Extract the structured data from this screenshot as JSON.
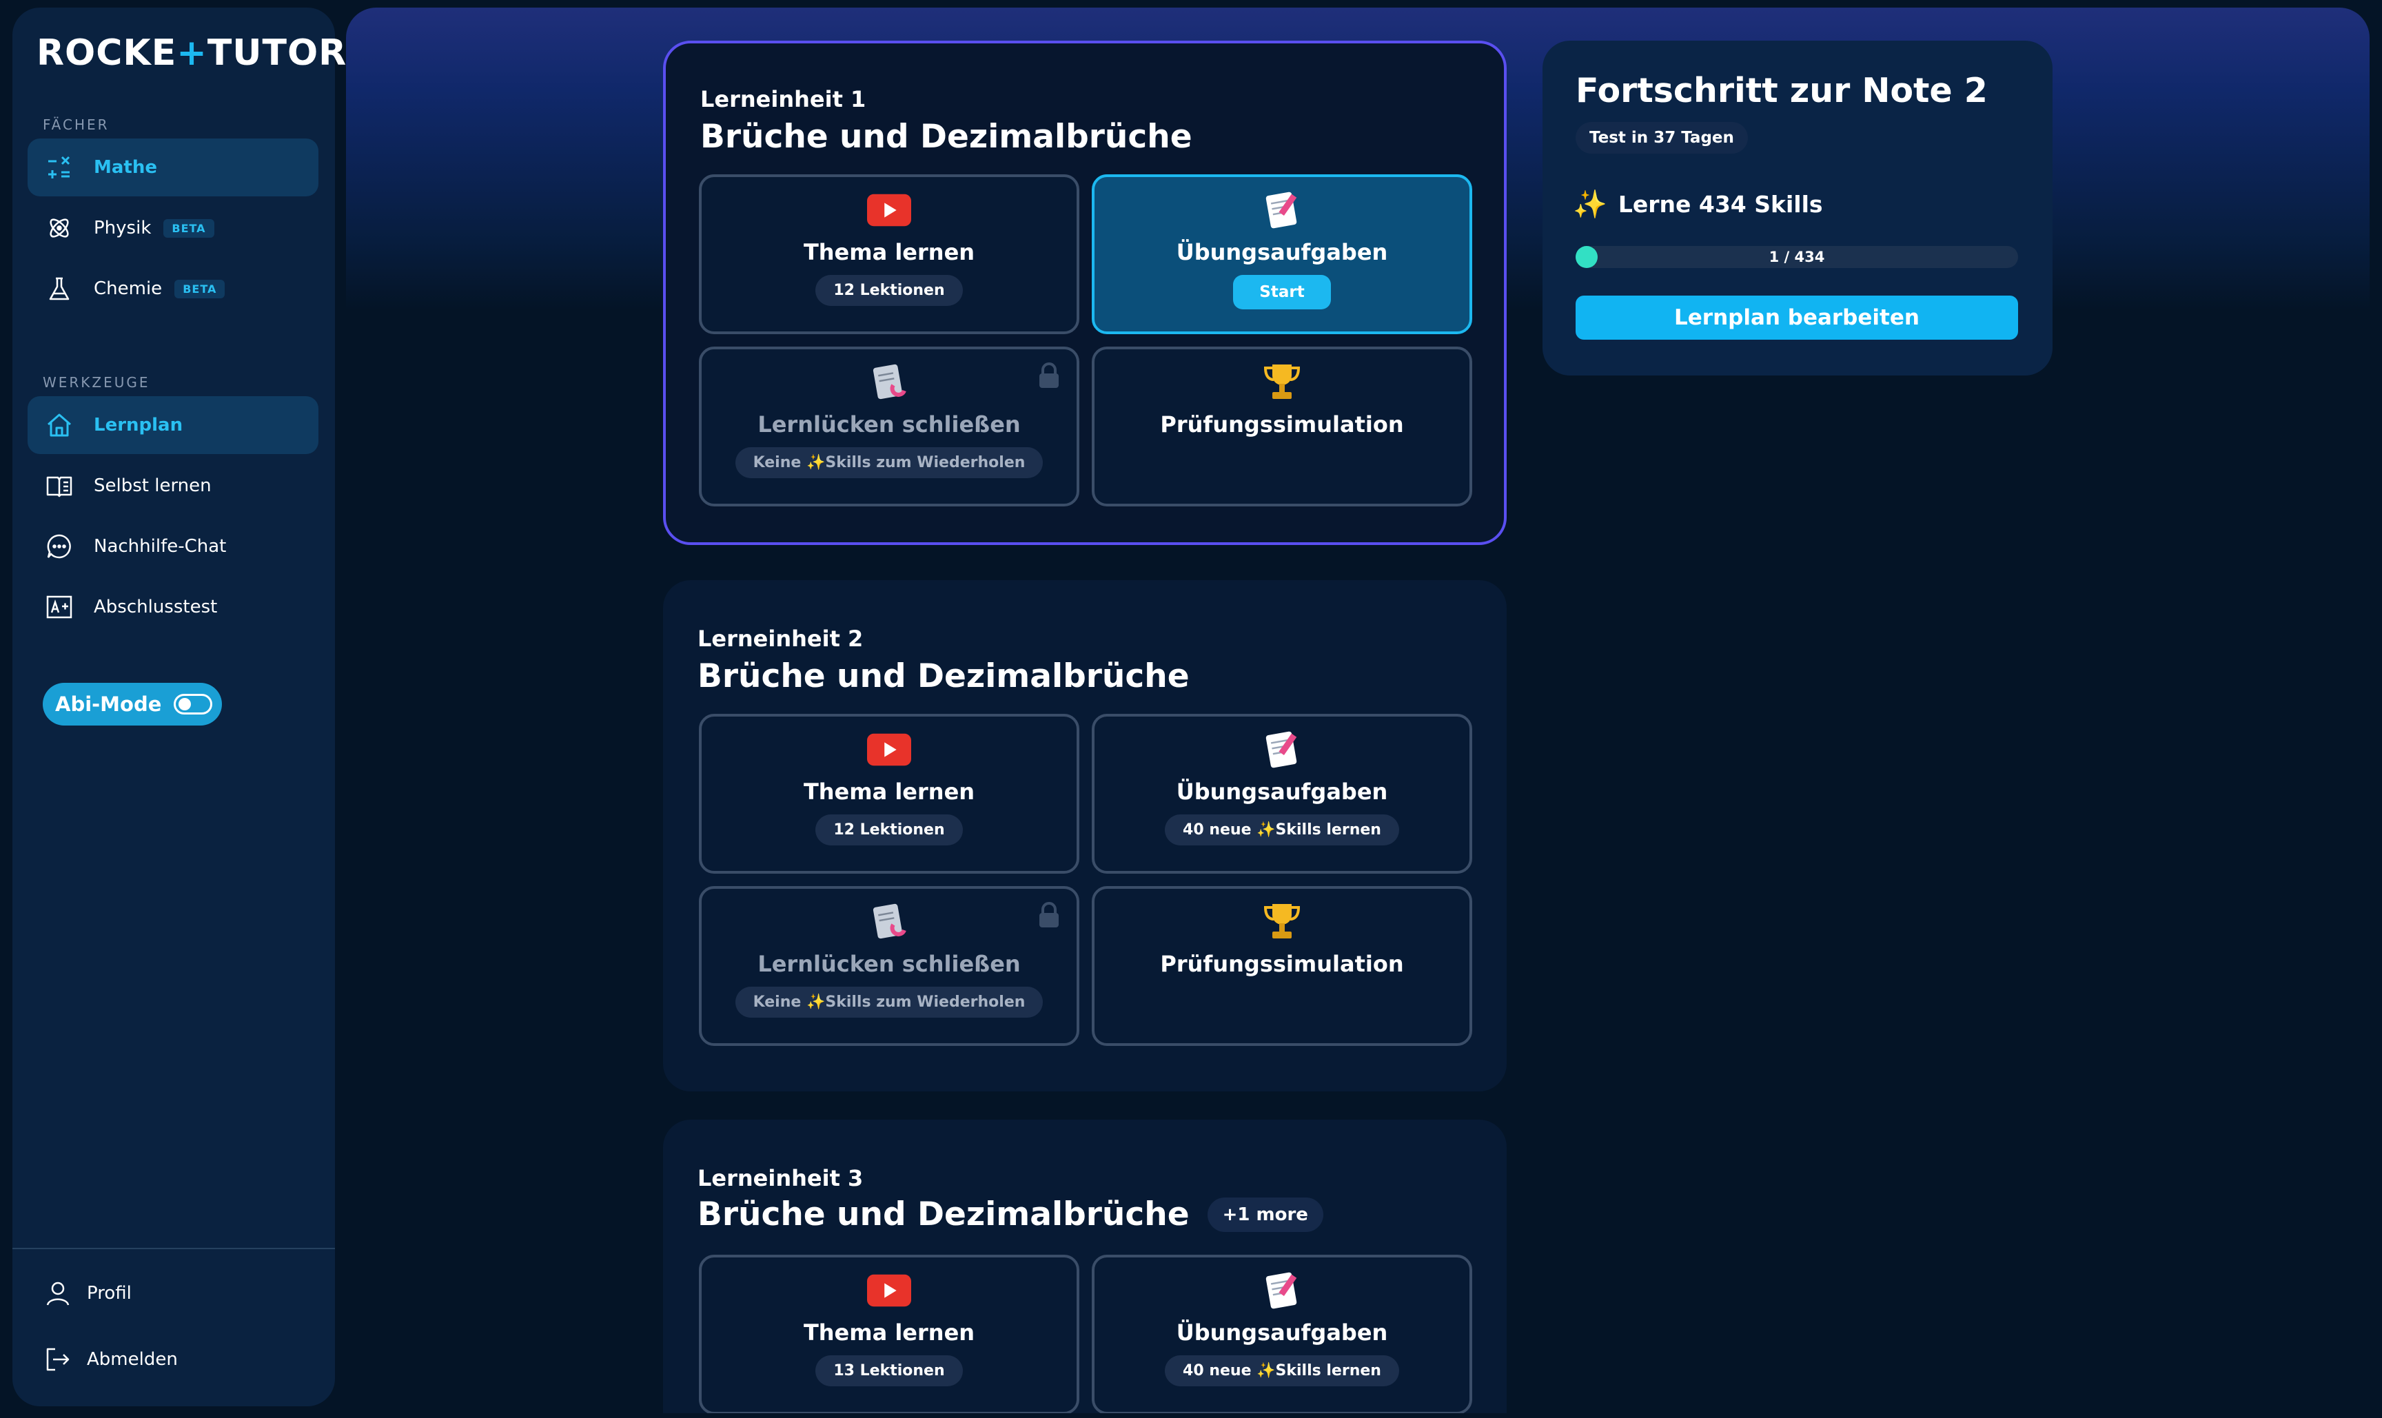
{
  "app": {
    "logo_text_a": "ROCKE",
    "logo_plus": "+",
    "logo_text_b": "TUTOR"
  },
  "sidebar": {
    "section_subjects": "FÄCHER",
    "subjects": [
      {
        "label": "Mathe",
        "icon": "math-operators-icon",
        "active": true
      },
      {
        "label": "Physik",
        "icon": "atom-icon",
        "badge": "BETA"
      },
      {
        "label": "Chemie",
        "icon": "flask-icon",
        "badge": "BETA"
      }
    ],
    "section_tools": "WERKZEUGE",
    "tools": [
      {
        "label": "Lernplan",
        "icon": "home-icon",
        "active": true
      },
      {
        "label": "Selbst lernen",
        "icon": "book-icon"
      },
      {
        "label": "Nachhilfe-Chat",
        "icon": "chat-icon"
      },
      {
        "label": "Abschlusstest",
        "icon": "grade-icon"
      }
    ],
    "abi_mode": "Abi-Mode",
    "bottom": [
      {
        "label": "Profil",
        "icon": "user-icon"
      },
      {
        "label": "Abmelden",
        "icon": "logout-icon"
      }
    ]
  },
  "units": [
    {
      "subtitle": "Lerneinheit 1",
      "title": "Brüche und Dezimalbrüche",
      "cards": {
        "topic": {
          "title": "Thema lernen",
          "pill": "12 Lektionen"
        },
        "exercises": {
          "title": "Übungsaufgaben",
          "button": "Start"
        },
        "gaps": {
          "title": "Lernlücken schließen",
          "pill": "Keine ✨Skills zum Wiederholen"
        },
        "exam": {
          "title": "Prüfungssimulation"
        }
      }
    },
    {
      "subtitle": "Lerneinheit 2",
      "title": "Brüche und Dezimalbrüche",
      "cards": {
        "topic": {
          "title": "Thema lernen",
          "pill": "12 Lektionen"
        },
        "exercises": {
          "title": "Übungsaufgaben",
          "pill": "40 neue ✨Skills lernen"
        },
        "gaps": {
          "title": "Lernlücken schließen",
          "pill": "Keine ✨Skills zum Wiederholen"
        },
        "exam": {
          "title": "Prüfungssimulation"
        }
      }
    },
    {
      "subtitle": "Lerneinheit 3",
      "title": "Brüche und Dezimalbrüche",
      "more": "+1 more",
      "cards": {
        "topic": {
          "title": "Thema lernen",
          "pill": "13 Lektionen"
        },
        "exercises": {
          "title": "Übungsaufgaben",
          "pill": "40 neue ✨Skills lernen"
        }
      }
    }
  ],
  "progress": {
    "title": "Fortschritt zur Note 2",
    "chip": "Test in 37 Tagen",
    "skills_icon": "✨",
    "skills_label": "Lerne 434 Skills",
    "bar_text": "1 / 434",
    "bar_fraction": 0.0023,
    "button": "Lernplan bearbeiten"
  },
  "colors": {
    "accent": "#1cb8f0",
    "active_border": "#5a4ff0",
    "progress_fill": "#32e0c4"
  }
}
